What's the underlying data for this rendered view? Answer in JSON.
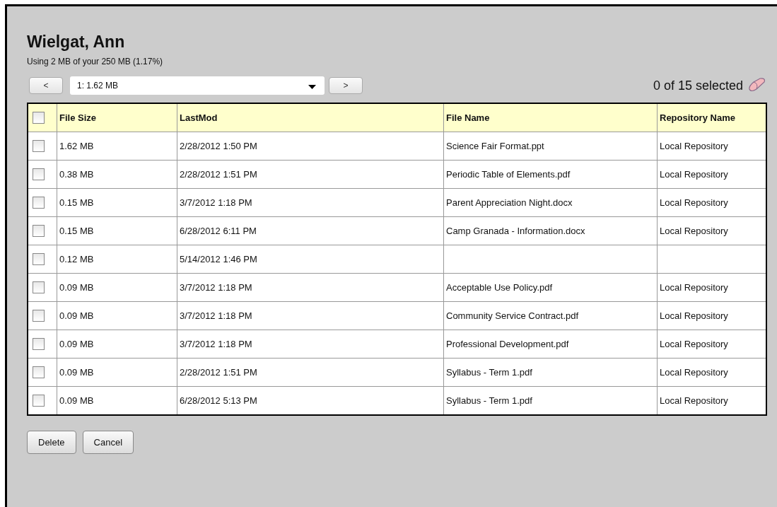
{
  "title": "Wielgat, Ann",
  "usage": "Using 2 MB of your 250 MB (1.17%)",
  "pager": {
    "prev": "<",
    "selected_option": "1: 1.62 MB",
    "next": ">"
  },
  "selection_count": "0 of 15 selected",
  "table": {
    "header_checked": false,
    "columns": [
      "File Size",
      "LastMod",
      "File Name",
      "Repository Name"
    ],
    "rows": [
      {
        "checked": false,
        "size": "1.62 MB",
        "modified": "2/28/2012 1:50 PM",
        "file_name": "Science Fair Format.ppt",
        "repository": "Local Repository"
      },
      {
        "checked": false,
        "size": "0.38 MB",
        "modified": "2/28/2012 1:51 PM",
        "file_name": "Periodic Table of Elements.pdf",
        "repository": "Local Repository"
      },
      {
        "checked": false,
        "size": "0.15 MB",
        "modified": "3/7/2012 1:18 PM",
        "file_name": "Parent Appreciation Night.docx",
        "repository": "Local Repository"
      },
      {
        "checked": false,
        "size": "0.15 MB",
        "modified": "6/28/2012 6:11 PM",
        "file_name": "Camp Granada - Information.docx",
        "repository": "Local Repository"
      },
      {
        "checked": false,
        "size": "0.12 MB",
        "modified": "5/14/2012 1:46 PM"
      },
      {
        "checked": false,
        "size": "0.09 MB",
        "modified": "3/7/2012 1:18 PM",
        "file_name": "Acceptable Use Policy.pdf",
        "repository": "Local Repository"
      },
      {
        "checked": false,
        "size": "0.09 MB",
        "modified": "3/7/2012 1:18 PM",
        "file_name": "Community Service Contract.pdf",
        "repository": "Local Repository"
      },
      {
        "checked": false,
        "size": "0.09 MB",
        "modified": "3/7/2012 1:18 PM",
        "file_name": "Professional Development.pdf",
        "repository": "Local Repository"
      },
      {
        "checked": false,
        "size": "0.09 MB",
        "modified": "2/28/2012 1:51 PM",
        "file_name": "Syllabus - Term 1.pdf",
        "repository": "Local Repository"
      },
      {
        "checked": false,
        "size": "0.09 MB",
        "modified": "6/28/2012 5:13 PM",
        "file_name": "Syllabus - Term 1.pdf",
        "repository": "Local Repository"
      }
    ]
  },
  "buttons": [
    "Delete",
    "Cancel"
  ]
}
